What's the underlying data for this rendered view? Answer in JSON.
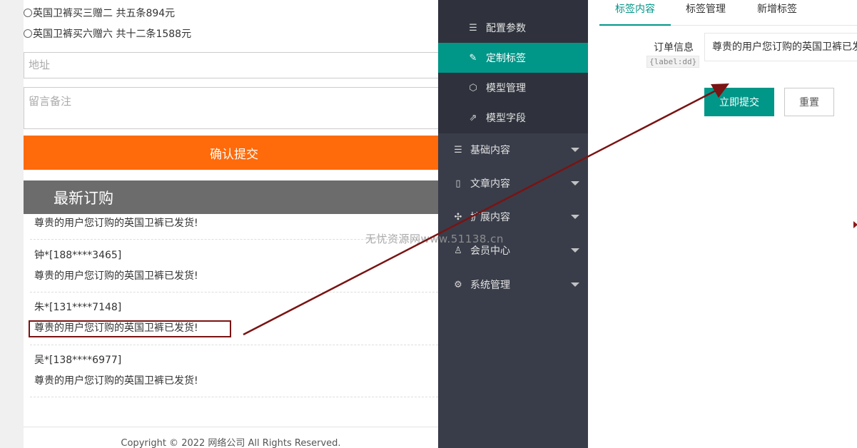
{
  "order_form": {
    "packages": [
      "英国卫裤买三赠二 共五条894元",
      "英国卫裤买六赠六 共十二条1588元"
    ],
    "address_placeholder": "地址",
    "remark_placeholder": "留言备注",
    "submit_label": "确认提交",
    "latest_orders_title": "最新订购",
    "orders": [
      {
        "name": "",
        "message": "尊贵的用户您订购的英国卫裤已发货!"
      },
      {
        "name": "钟*[188****3465]",
        "message": "尊贵的用户您订购的英国卫裤已发货!"
      },
      {
        "name": "朱*[131****7148]",
        "message": "尊贵的用户您订购的英国卫裤已发货!"
      },
      {
        "name": "吴*[138****6977]",
        "message": "尊贵的用户您订购的英国卫裤已发货!"
      }
    ],
    "copyright": "Copyright © 2022 网络公司 All Rights Reserved."
  },
  "watermark": "无忧资源网www.51138.cn",
  "sidebar": {
    "sub_items": [
      {
        "label": "配置参数",
        "icon": "sliders-icon"
      },
      {
        "label": "定制标签",
        "icon": "wrench-icon",
        "active": true
      },
      {
        "label": "模型管理",
        "icon": "cube-icon"
      },
      {
        "label": "模型字段",
        "icon": "external-link-icon"
      }
    ],
    "menu_items": [
      {
        "label": "基础内容",
        "icon": "sliders-icon"
      },
      {
        "label": "文章内容",
        "icon": "document-icon"
      },
      {
        "label": "扩展内容",
        "icon": "expand-icon"
      },
      {
        "label": "会员中心",
        "icon": "user-icon"
      },
      {
        "label": "系统管理",
        "icon": "gear-icon"
      }
    ]
  },
  "editor": {
    "tabs": [
      "标签内容",
      "标签管理",
      "新增标签"
    ],
    "field_label": "订单信息",
    "field_hint": "{label:dd}",
    "field_value": "尊贵的用户您订购的英国卫裤已发货!",
    "submit_label": "立即提交",
    "reset_label": "重置"
  },
  "colors": {
    "accent": "#009688",
    "order_button": "#ff6a0a",
    "sidebar": "#393d49",
    "annotation": "#7a1313"
  }
}
